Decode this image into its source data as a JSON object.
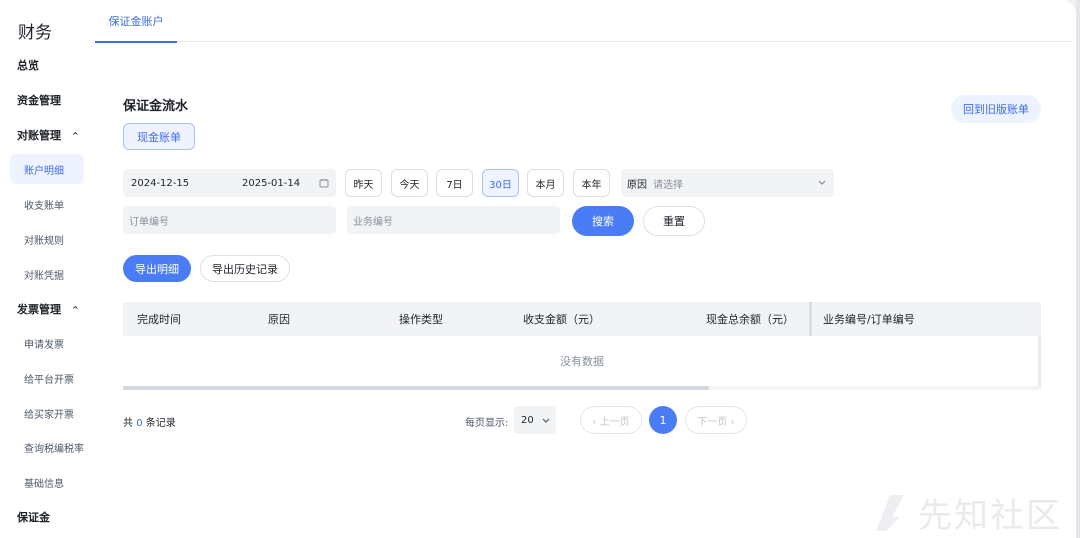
{
  "sidebar": {
    "app_title": "财务",
    "overview": "总览",
    "funds": "资金管理",
    "reconcile": "对账管理",
    "reconcile_items": [
      "账户明细",
      "收支账单",
      "对账规则",
      "对账凭据"
    ],
    "invoice": "发票管理",
    "invoice_items": [
      "申请发票",
      "给平台开票",
      "给买家开票",
      "查询税编税率",
      "基础信息"
    ],
    "deposit": "保证金",
    "caret": "^"
  },
  "tabs": {
    "active": "保证金账户"
  },
  "main": {
    "section_title": "保证金流水",
    "old_version_button": "回到旧版账单",
    "cash_tab": "现金账单"
  },
  "filters": {
    "start_date": "2024-12-15",
    "end_date": "2025-01-14",
    "quick_ranges": [
      "昨天",
      "今天",
      "7日",
      "30日",
      "本月",
      "本年"
    ],
    "selected_range": "30日",
    "reason_label": "原因",
    "reason_placeholder": "请选择",
    "order_placeholder": "订单编号",
    "business_placeholder": "业务编号",
    "search_button": "搜索",
    "reset_button": "重置"
  },
  "export": {
    "export_detail": "导出明细",
    "export_history": "导出历史记录"
  },
  "table": {
    "columns": [
      "完成时间",
      "原因",
      "操作类型",
      "收支金额（元）",
      "现金总余额（元）",
      "业务编号/订单编号"
    ],
    "empty_text": "没有数据"
  },
  "pagination": {
    "total_prefix": "共",
    "total_count": "0",
    "total_suffix": "条记录",
    "page_size_label": "每页显示:",
    "page_size": "20",
    "prev": "‹ 上一页",
    "next": "下一页 ›",
    "current_page": "1"
  },
  "watermark": {
    "text": "先知社区"
  },
  "colors": {
    "accent": "#4a7cf6",
    "accent_light": "#eef3ff"
  }
}
